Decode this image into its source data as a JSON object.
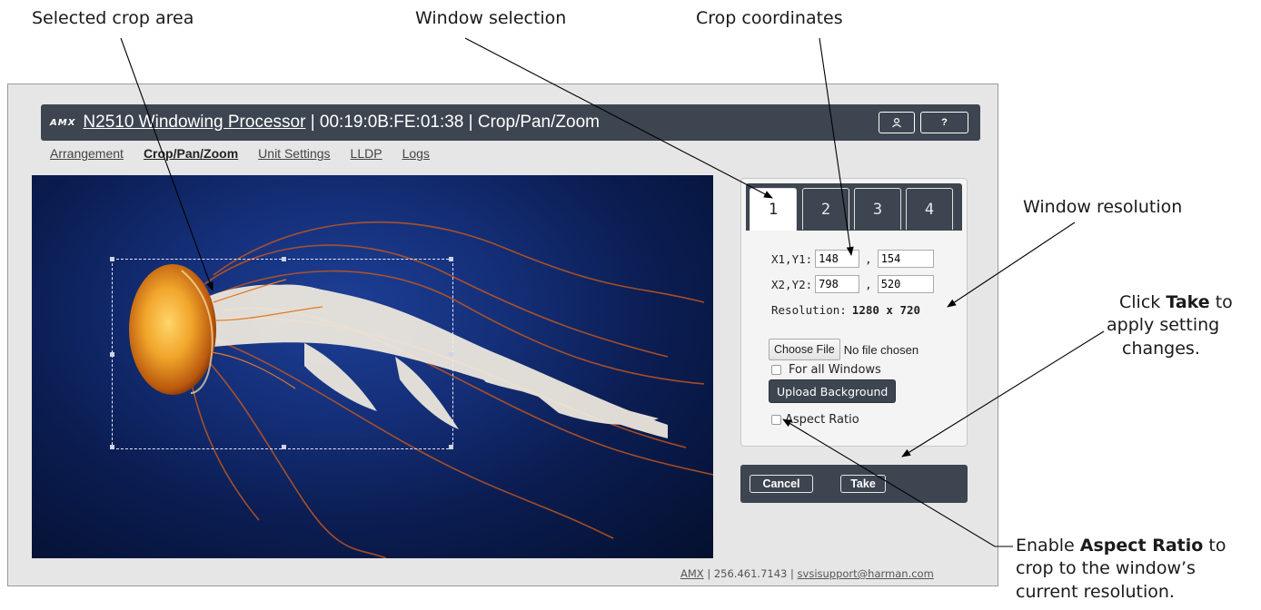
{
  "callouts": {
    "selected_crop_area": "Selected crop area",
    "window_selection": "Window selection",
    "crop_coordinates": "Crop coordinates",
    "window_resolution": "Window resolution",
    "take_line1_pre": "Click ",
    "take_bold": "Take",
    "take_line1_post": " to",
    "take_line2": "apply setting",
    "take_line3": "changes.",
    "aspect_line1_pre": "Enable ",
    "aspect_bold": "Aspect Ratio",
    "aspect_line1_post": " to",
    "aspect_line2": "crop to the window’s",
    "aspect_line3": "current resolution."
  },
  "app": {
    "logo": "AMX",
    "device_link": "N2510 Windowing Processor",
    "title_rest": " | 00:19:0B:FE:01:38 | Crop/Pan/Zoom",
    "user_icon_label": "⌂",
    "help_label": "?"
  },
  "nav": {
    "items": [
      "Arrangement",
      "Crop/Pan/Zoom",
      "Unit Settings",
      "LLDP",
      "Logs"
    ],
    "active": "Crop/Pan/Zoom"
  },
  "panel": {
    "tabs": [
      "1",
      "2",
      "3",
      "4"
    ],
    "active_tab": "1",
    "x1y1_label": "X1,Y1:",
    "x1": "148",
    "y1": "154",
    "x2y2_label": "X2,Y2:",
    "x2": "798",
    "y2": "520",
    "comma": ",",
    "resolution_label": "Resolution:",
    "resolution_value": "1280 x 720",
    "choose_file": "Choose File",
    "no_file": "No file chosen",
    "for_all_windows": "For all Windows",
    "upload_background": "Upload Background",
    "aspect_ratio": "Aspect Ratio"
  },
  "actions": {
    "cancel": "Cancel",
    "take": "Take"
  },
  "footer": {
    "brand": "AMX",
    "phone": " | 256.461.7143 | ",
    "email": "svsisupport@harman.com"
  },
  "colors": {
    "bar": "#3d4550",
    "frame": "#e6e6e6"
  }
}
